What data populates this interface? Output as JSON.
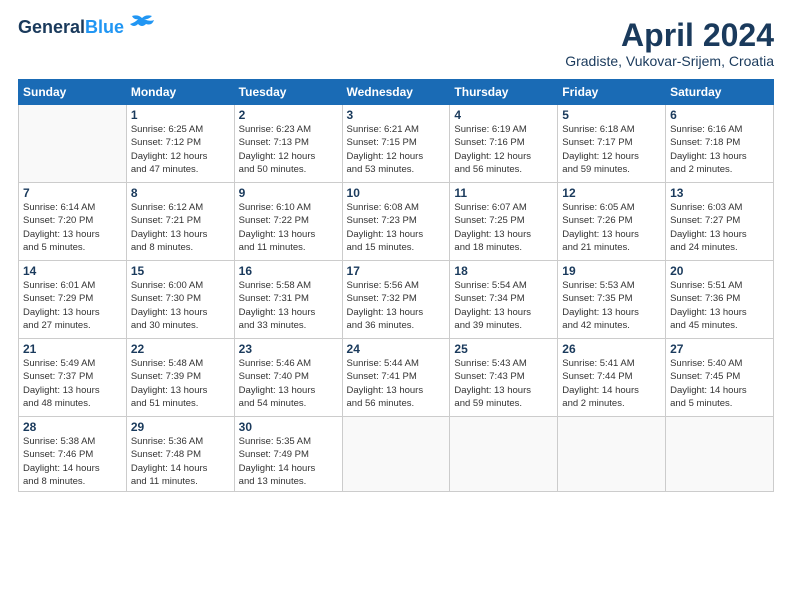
{
  "header": {
    "logo_line1": "General",
    "logo_line2": "Blue",
    "title": "April 2024",
    "subtitle": "Gradiste, Vukovar-Srijem, Croatia"
  },
  "weekdays": [
    "Sunday",
    "Monday",
    "Tuesday",
    "Wednesday",
    "Thursday",
    "Friday",
    "Saturday"
  ],
  "weeks": [
    [
      {
        "day": "",
        "info": ""
      },
      {
        "day": "1",
        "info": "Sunrise: 6:25 AM\nSunset: 7:12 PM\nDaylight: 12 hours\nand 47 minutes."
      },
      {
        "day": "2",
        "info": "Sunrise: 6:23 AM\nSunset: 7:13 PM\nDaylight: 12 hours\nand 50 minutes."
      },
      {
        "day": "3",
        "info": "Sunrise: 6:21 AM\nSunset: 7:15 PM\nDaylight: 12 hours\nand 53 minutes."
      },
      {
        "day": "4",
        "info": "Sunrise: 6:19 AM\nSunset: 7:16 PM\nDaylight: 12 hours\nand 56 minutes."
      },
      {
        "day": "5",
        "info": "Sunrise: 6:18 AM\nSunset: 7:17 PM\nDaylight: 12 hours\nand 59 minutes."
      },
      {
        "day": "6",
        "info": "Sunrise: 6:16 AM\nSunset: 7:18 PM\nDaylight: 13 hours\nand 2 minutes."
      }
    ],
    [
      {
        "day": "7",
        "info": "Sunrise: 6:14 AM\nSunset: 7:20 PM\nDaylight: 13 hours\nand 5 minutes."
      },
      {
        "day": "8",
        "info": "Sunrise: 6:12 AM\nSunset: 7:21 PM\nDaylight: 13 hours\nand 8 minutes."
      },
      {
        "day": "9",
        "info": "Sunrise: 6:10 AM\nSunset: 7:22 PM\nDaylight: 13 hours\nand 11 minutes."
      },
      {
        "day": "10",
        "info": "Sunrise: 6:08 AM\nSunset: 7:23 PM\nDaylight: 13 hours\nand 15 minutes."
      },
      {
        "day": "11",
        "info": "Sunrise: 6:07 AM\nSunset: 7:25 PM\nDaylight: 13 hours\nand 18 minutes."
      },
      {
        "day": "12",
        "info": "Sunrise: 6:05 AM\nSunset: 7:26 PM\nDaylight: 13 hours\nand 21 minutes."
      },
      {
        "day": "13",
        "info": "Sunrise: 6:03 AM\nSunset: 7:27 PM\nDaylight: 13 hours\nand 24 minutes."
      }
    ],
    [
      {
        "day": "14",
        "info": "Sunrise: 6:01 AM\nSunset: 7:29 PM\nDaylight: 13 hours\nand 27 minutes."
      },
      {
        "day": "15",
        "info": "Sunrise: 6:00 AM\nSunset: 7:30 PM\nDaylight: 13 hours\nand 30 minutes."
      },
      {
        "day": "16",
        "info": "Sunrise: 5:58 AM\nSunset: 7:31 PM\nDaylight: 13 hours\nand 33 minutes."
      },
      {
        "day": "17",
        "info": "Sunrise: 5:56 AM\nSunset: 7:32 PM\nDaylight: 13 hours\nand 36 minutes."
      },
      {
        "day": "18",
        "info": "Sunrise: 5:54 AM\nSunset: 7:34 PM\nDaylight: 13 hours\nand 39 minutes."
      },
      {
        "day": "19",
        "info": "Sunrise: 5:53 AM\nSunset: 7:35 PM\nDaylight: 13 hours\nand 42 minutes."
      },
      {
        "day": "20",
        "info": "Sunrise: 5:51 AM\nSunset: 7:36 PM\nDaylight: 13 hours\nand 45 minutes."
      }
    ],
    [
      {
        "day": "21",
        "info": "Sunrise: 5:49 AM\nSunset: 7:37 PM\nDaylight: 13 hours\nand 48 minutes."
      },
      {
        "day": "22",
        "info": "Sunrise: 5:48 AM\nSunset: 7:39 PM\nDaylight: 13 hours\nand 51 minutes."
      },
      {
        "day": "23",
        "info": "Sunrise: 5:46 AM\nSunset: 7:40 PM\nDaylight: 13 hours\nand 54 minutes."
      },
      {
        "day": "24",
        "info": "Sunrise: 5:44 AM\nSunset: 7:41 PM\nDaylight: 13 hours\nand 56 minutes."
      },
      {
        "day": "25",
        "info": "Sunrise: 5:43 AM\nSunset: 7:43 PM\nDaylight: 13 hours\nand 59 minutes."
      },
      {
        "day": "26",
        "info": "Sunrise: 5:41 AM\nSunset: 7:44 PM\nDaylight: 14 hours\nand 2 minutes."
      },
      {
        "day": "27",
        "info": "Sunrise: 5:40 AM\nSunset: 7:45 PM\nDaylight: 14 hours\nand 5 minutes."
      }
    ],
    [
      {
        "day": "28",
        "info": "Sunrise: 5:38 AM\nSunset: 7:46 PM\nDaylight: 14 hours\nand 8 minutes."
      },
      {
        "day": "29",
        "info": "Sunrise: 5:36 AM\nSunset: 7:48 PM\nDaylight: 14 hours\nand 11 minutes."
      },
      {
        "day": "30",
        "info": "Sunrise: 5:35 AM\nSunset: 7:49 PM\nDaylight: 14 hours\nand 13 minutes."
      },
      {
        "day": "",
        "info": ""
      },
      {
        "day": "",
        "info": ""
      },
      {
        "day": "",
        "info": ""
      },
      {
        "day": "",
        "info": ""
      }
    ]
  ]
}
